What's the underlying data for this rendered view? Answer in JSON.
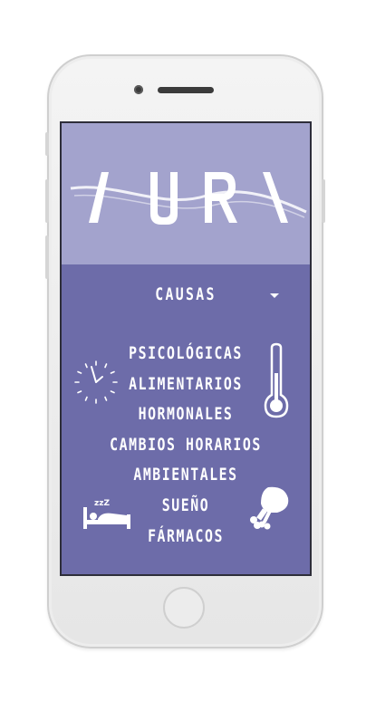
{
  "app": {
    "logo_text": "AURA"
  },
  "menu": {
    "title": "CAUSAS",
    "items": [
      "PSICOLÓGICAS",
      "ALIMENTARIOS",
      "HORMONALES",
      "CAMBIOS HORARIOS",
      "AMBIENTALES",
      "SUEÑO",
      "FÁRMACOS"
    ]
  },
  "icons": {
    "clock": "clock-icon",
    "thermometer": "thermometer-icon",
    "bed": "sleeping-bed-icon",
    "food": "chicken-leg-icon",
    "dropdown": "caret-down-icon"
  },
  "colors": {
    "header_bg": "#a3a3cd",
    "screen_bg": "#6d6ca9",
    "text": "#ffffff"
  }
}
